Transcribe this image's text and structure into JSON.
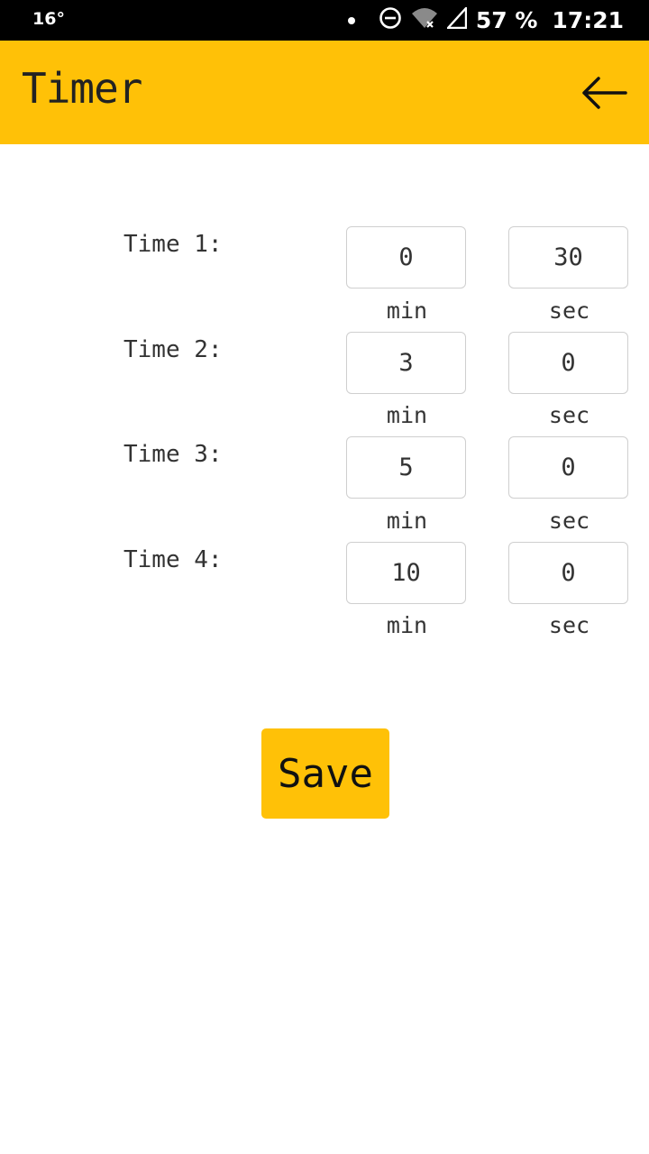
{
  "status_bar": {
    "temperature": "16°",
    "battery": "57 %",
    "time": "17:21"
  },
  "app_bar": {
    "title": "Timer",
    "back_icon": "arrow-left-icon"
  },
  "timers": [
    {
      "label": "Time 1:",
      "min": "0",
      "sec": "30",
      "min_unit": "min",
      "sec_unit": "sec"
    },
    {
      "label": "Time 2:",
      "min": "3",
      "sec": "0",
      "min_unit": "min",
      "sec_unit": "sec"
    },
    {
      "label": "Time 3:",
      "min": "5",
      "sec": "0",
      "min_unit": "min",
      "sec_unit": "sec"
    },
    {
      "label": "Time 4:",
      "min": "10",
      "sec": "0",
      "min_unit": "min",
      "sec_unit": "sec"
    }
  ],
  "save_label": "Save",
  "colors": {
    "accent": "#FFC107",
    "status_bar": "#000000"
  }
}
